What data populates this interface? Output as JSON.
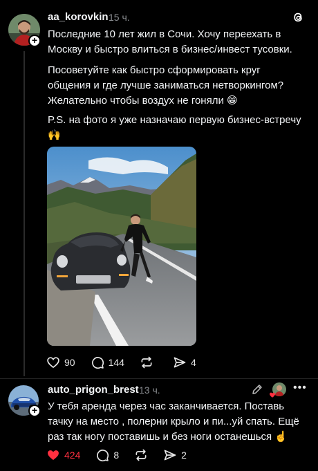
{
  "post": {
    "username": "aa_korovkin",
    "time": "15 ч.",
    "paragraphs": [
      "Последние 10 лет жил в Сочи. Хочу переехать в Москву и быстро влиться в бизнес/инвест тусовки.",
      "Посоветуйте как быстро сформировать круг общения и где лучше заниматься нетворкингом? Желательно чтобы воздух не гоняли 😁",
      "P.S. на фото я уже назначаю первую бизнес-встречу 🙌"
    ],
    "likes": "90",
    "comments": "144",
    "reposts": "",
    "shares": "4"
  },
  "reply": {
    "username": "auto_prigon_brest",
    "time": "13 ч.",
    "text": "У тебя аренда через час заканчивается. Поставь тачку на место , полерни крыло и пи...уй спать. Ещё раз так ногу поставишь и без ноги останешься ☝️",
    "likes": "424",
    "comments": "8",
    "shares": "2"
  },
  "colors": {
    "background": "#000000",
    "text": "#f3f5f7",
    "muted": "#8a8d91",
    "like_active": "#ff3040"
  },
  "icons": [
    "threads-logo-icon",
    "follow-plus-icon",
    "heart-icon",
    "comment-icon",
    "repost-icon",
    "share-icon",
    "edit-icon",
    "more-icon"
  ]
}
